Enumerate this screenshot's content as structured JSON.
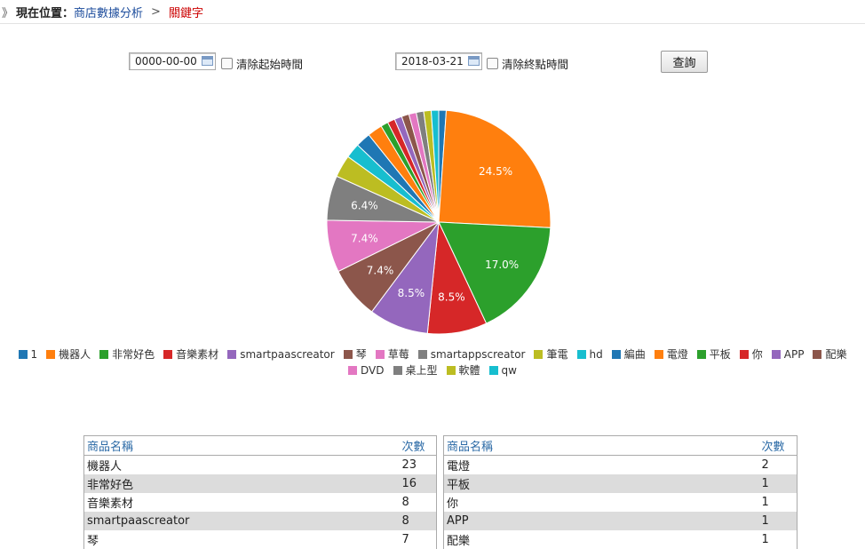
{
  "breadcrumb": {
    "marker": "》",
    "label": "現在位置：",
    "parent": "商店數據分析",
    "separator": ">",
    "current": "關鍵字"
  },
  "filters": {
    "start_date": "0000-00-00",
    "clear_start_label": "清除起始時間",
    "end_date": "2018-03-21",
    "clear_end_label": "清除終點時間",
    "query_label": "查詢"
  },
  "chart_data": {
    "type": "pie",
    "slices": [
      {
        "name": "1",
        "value": 1,
        "color": "#1f77b4"
      },
      {
        "name": "機器人",
        "value": 23,
        "color": "#ff7f0e",
        "label": "24.5%"
      },
      {
        "name": "非常好色",
        "value": 16,
        "color": "#2ca02c",
        "label": "17.0%"
      },
      {
        "name": "音樂素材",
        "value": 8,
        "color": "#d62728",
        "label": "8.5%"
      },
      {
        "name": "smartpaascreator",
        "value": 8,
        "color": "#9467bd",
        "label": "8.5%"
      },
      {
        "name": "琴",
        "value": 7,
        "color": "#8c564b",
        "label": "7.4%"
      },
      {
        "name": "草莓",
        "value": 7,
        "color": "#e377c2",
        "label": "7.4%"
      },
      {
        "name": "smartappscreator",
        "value": 6,
        "color": "#7f7f7f",
        "label": "6.4%"
      },
      {
        "name": "筆電",
        "value": 3,
        "color": "#bcbd22"
      },
      {
        "name": "hd",
        "value": 2,
        "color": "#17becf"
      },
      {
        "name": "編曲",
        "value": 2,
        "color": "#1f77b4"
      },
      {
        "name": "電燈",
        "value": 2,
        "color": "#ff7f0e"
      },
      {
        "name": "平板",
        "value": 1,
        "color": "#2ca02c"
      },
      {
        "name": "你",
        "value": 1,
        "color": "#d62728"
      },
      {
        "name": "APP",
        "value": 1,
        "color": "#9467bd"
      },
      {
        "name": "配樂",
        "value": 1,
        "color": "#8c564b"
      },
      {
        "name": "DVD",
        "value": 1,
        "color": "#e377c2"
      },
      {
        "name": "桌上型",
        "value": 1,
        "color": "#7f7f7f"
      },
      {
        "name": "軟體",
        "value": 1,
        "color": "#bcbd22"
      },
      {
        "name": "qw",
        "value": 1,
        "color": "#17becf"
      }
    ]
  },
  "table_left": {
    "headers": [
      "商品名稱",
      "次數"
    ],
    "rows": [
      [
        "機器人",
        "23"
      ],
      [
        "非常好色",
        "16"
      ],
      [
        "音樂素材",
        "8"
      ],
      [
        "smartpaascreator",
        "8"
      ],
      [
        "琴",
        "7"
      ]
    ]
  },
  "table_right": {
    "headers": [
      "商品名稱",
      "次數"
    ],
    "rows": [
      [
        "電燈",
        "2"
      ],
      [
        "平板",
        "1"
      ],
      [
        "你",
        "1"
      ],
      [
        "APP",
        "1"
      ],
      [
        "配樂",
        "1"
      ]
    ]
  }
}
